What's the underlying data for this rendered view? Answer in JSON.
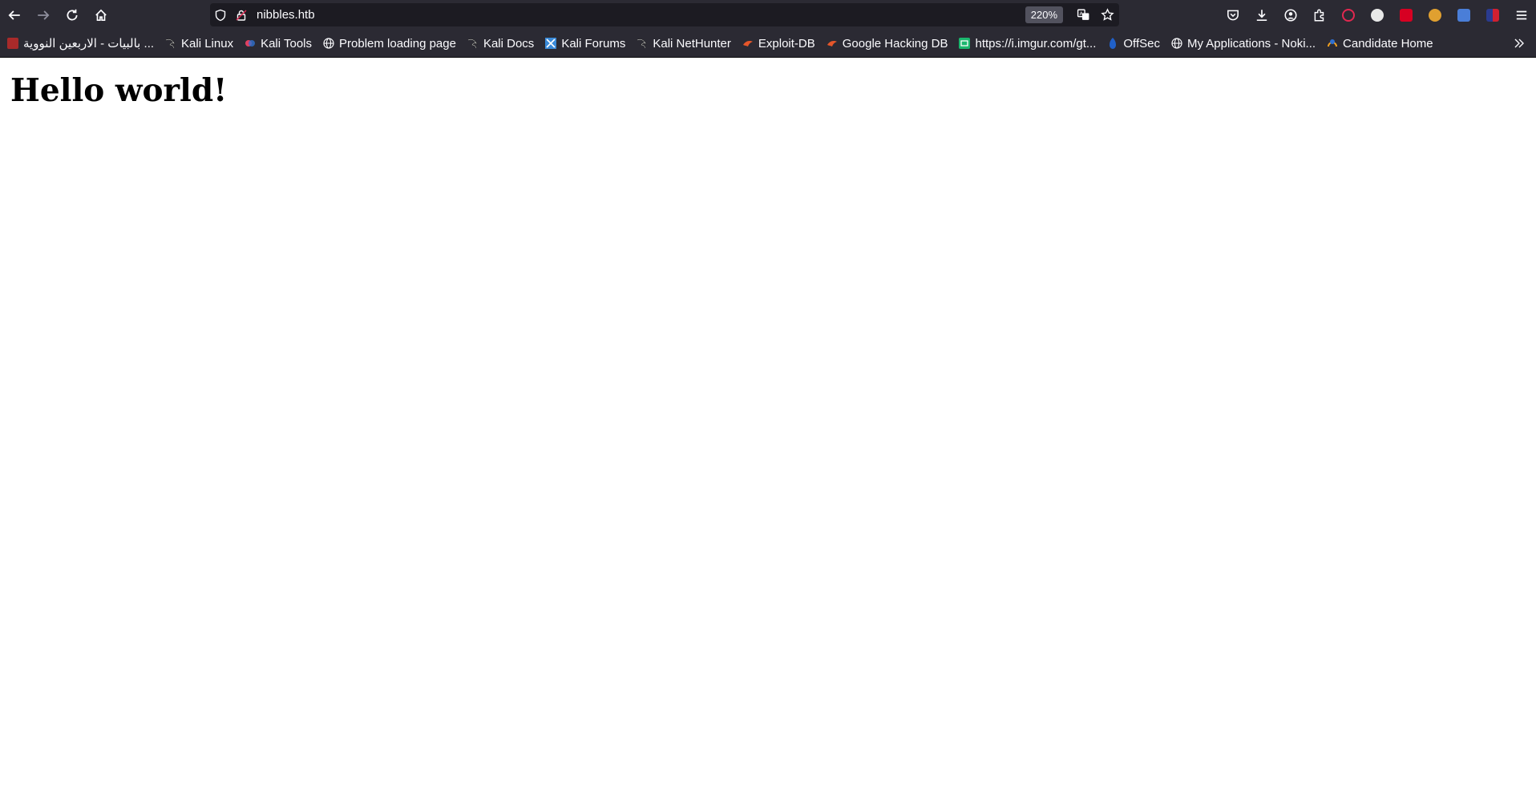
{
  "browser": {
    "url": "nibbles.htb",
    "zoom": "220%",
    "bookmarks": [
      {
        "label": "... بالبيات - الاربعين النووية",
        "icon": "red-square-icon"
      },
      {
        "label": "Kali Linux",
        "icon": "kali-dragon-icon"
      },
      {
        "label": "Kali Tools",
        "icon": "kali-tools-icon"
      },
      {
        "label": "Problem loading page",
        "icon": "globe-icon"
      },
      {
        "label": "Kali Docs",
        "icon": "kali-dragon-icon"
      },
      {
        "label": "Kali Forums",
        "icon": "kali-forums-icon"
      },
      {
        "label": "Kali NetHunter",
        "icon": "kali-dragon-icon"
      },
      {
        "label": "Exploit-DB",
        "icon": "exploit-db-icon"
      },
      {
        "label": "Google Hacking DB",
        "icon": "exploit-db-icon"
      },
      {
        "label": "https://i.imgur.com/gt...",
        "icon": "imgur-icon"
      },
      {
        "label": "OffSec",
        "icon": "offsec-icon"
      },
      {
        "label": "My Applications - Noki...",
        "icon": "globe-icon"
      },
      {
        "label": "Candidate Home",
        "icon": "candidate-icon"
      }
    ]
  },
  "page": {
    "heading": "Hello world!"
  },
  "colors": {
    "toolbar_bg": "#2b2a33",
    "urlbar_bg": "#1c1b22",
    "text_light": "#fbfbfe",
    "page_bg": "#ffffff"
  }
}
